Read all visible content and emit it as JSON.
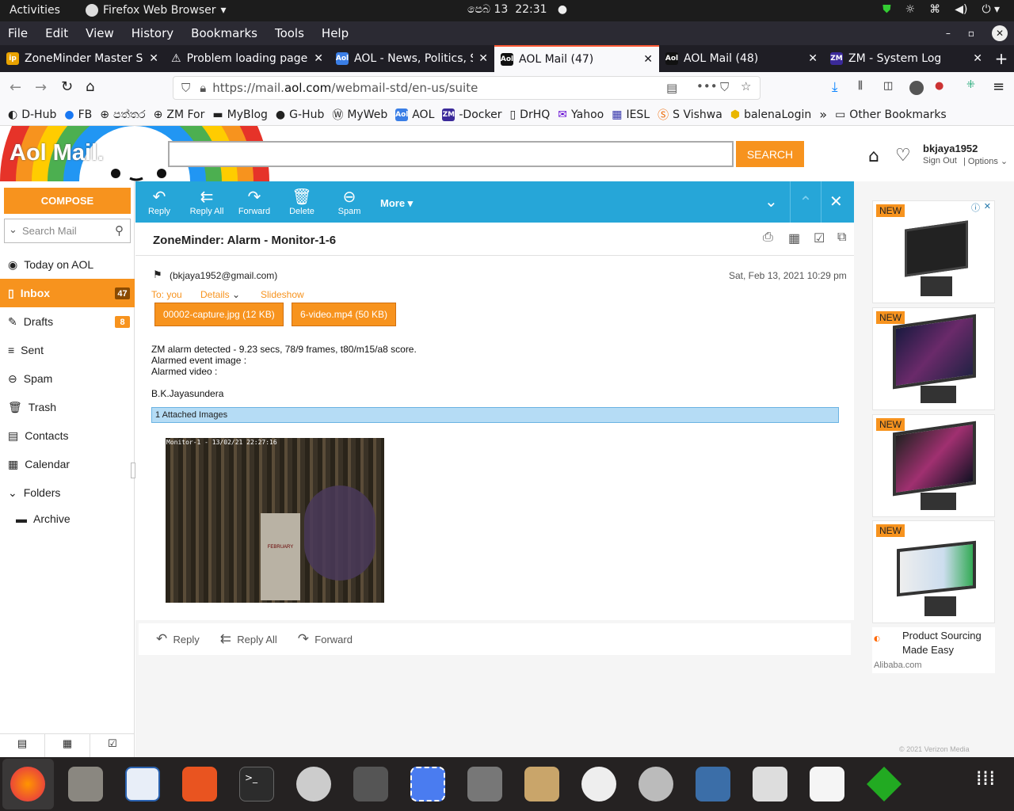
{
  "system": {
    "activities": "Activities",
    "app_name": "Firefox Web Browser",
    "clock_date": "පෙබ 13",
    "clock_time": "22:31"
  },
  "menubar": [
    "File",
    "Edit",
    "View",
    "History",
    "Bookmarks",
    "Tools",
    "Help"
  ],
  "tabs": [
    {
      "title": "ZoneMinder Master Sr",
      "icon": "ip-icon",
      "color": "#e8a200"
    },
    {
      "title": "Problem loading page",
      "icon": "warning-icon",
      "color": "#fbfbfe"
    },
    {
      "title": "AOL - News, Politics, S",
      "icon": "aol-icon",
      "color": "#3a7ee6"
    },
    {
      "title": "AOL Mail (47)",
      "icon": "aol-mail-icon",
      "color": "#111"
    },
    {
      "title": "AOL Mail (48)",
      "icon": "aol-mail-icon",
      "color": "#111"
    },
    {
      "title": "ZM - System Log",
      "icon": "zm-icon",
      "color": "#3b2a9a"
    }
  ],
  "url": {
    "prefix": "https://mail.",
    "domain": "aol.com",
    "suffix": "/webmail-std/en-us/suite"
  },
  "bookmarks": [
    "D-Hub",
    "FB",
    "පත්තර",
    "ZM For",
    "MyBlog",
    "G-Hub",
    "MyWeb",
    "AOL",
    "-Docker",
    "DrHQ",
    "Yahoo",
    "IESL",
    "S Vishwa",
    "balenaLogin"
  ],
  "bookmarks_other": "Other Bookmarks",
  "aol": {
    "logo": "Aol Mail.",
    "search_button": "SEARCH",
    "username": "bkjaya1952",
    "sign_out": "Sign Out",
    "options": "Options"
  },
  "nav": {
    "compose": "COMPOSE",
    "search_placeholder": "Search Mail",
    "items": [
      {
        "label": "Today on AOL",
        "count": ""
      },
      {
        "label": "Inbox",
        "count": "47"
      },
      {
        "label": "Drafts",
        "count": "8"
      },
      {
        "label": "Sent",
        "count": ""
      },
      {
        "label": "Spam",
        "count": ""
      },
      {
        "label": "Trash",
        "count": ""
      },
      {
        "label": "Contacts",
        "count": ""
      },
      {
        "label": "Calendar",
        "count": ""
      },
      {
        "label": "Folders",
        "count": ""
      }
    ],
    "archive": "Archive"
  },
  "toolbar": {
    "reply": "Reply",
    "reply_all": "Reply All",
    "forward": "Forward",
    "delete": "Delete",
    "spam": "Spam",
    "more": "More"
  },
  "message": {
    "subject": "ZoneMinder: Alarm - Monitor-1-6",
    "from": "(bkjaya1952@gmail.com)",
    "date": "Sat, Feb 13, 2021 10:29 pm",
    "to": "To: you",
    "details": "Details",
    "slideshow": "Slideshow",
    "attachments": [
      "00002-capture.jpg (12 KB)",
      "6-video.mp4 (50 KB)"
    ],
    "body": [
      "ZM alarm detected - 9.23 secs, 78/9 frames, t80/m15/a8 score.",
      "Alarmed event image :",
      "Alarmed video :"
    ],
    "signature": "B.K.Jayasundera",
    "attached_images": "1 Attached Images",
    "cam_overlay": "Monitor-1 - 13/02/21 22:27:16",
    "calendar_month": "FEBRUARY"
  },
  "replybar": {
    "reply": "Reply",
    "reply_all": "Reply All",
    "forward": "Forward"
  },
  "ads": {
    "badge": "NEW",
    "title": "Product Sourcing Made Easy",
    "source": "Alibaba.com",
    "footer": "© 2021 Verizon Media"
  }
}
